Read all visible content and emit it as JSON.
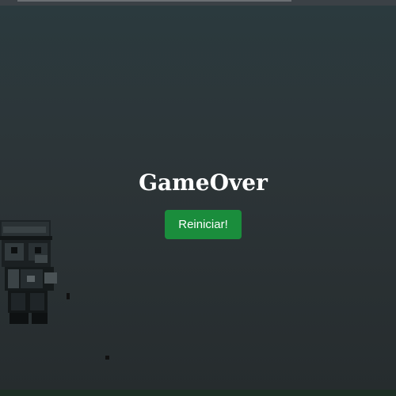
{
  "game": {
    "status_title": "GameOver",
    "restart_label": "Reiniciar!"
  },
  "colors": {
    "background": "#2c3437",
    "button": "#1a8d3c",
    "title_text": "#ffffff"
  },
  "icons": {
    "player_sprite": "pixel-character-icon"
  }
}
